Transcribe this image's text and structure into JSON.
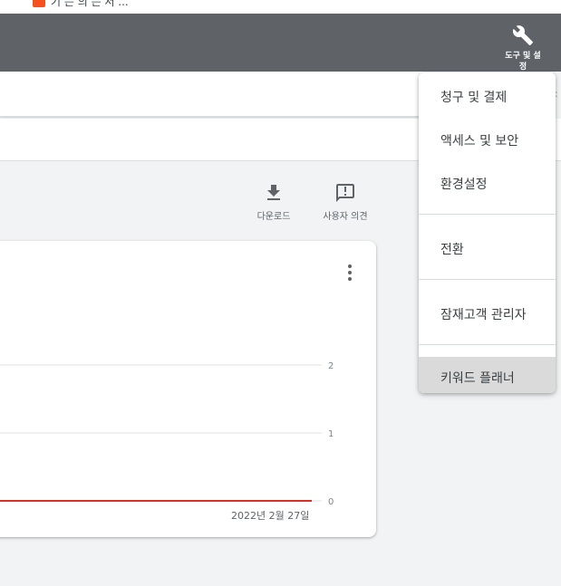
{
  "browser": {
    "bookmark_text": "기 는 의 는 서 ..."
  },
  "header": {
    "tools_label_line1": "도구 및 설",
    "tools_label_line2": "정",
    "tools_icon": "wrench-icon"
  },
  "toolbar": {
    "download_label": "다운로드",
    "feedback_label": "사용자 의견"
  },
  "chart_data": {
    "type": "line",
    "y_ticks": [
      "2",
      "1",
      "0"
    ],
    "ylim": [
      0,
      2
    ],
    "x_end_label": "2022년 2월 27일",
    "series": [
      {
        "values": [
          0,
          0
        ]
      }
    ],
    "series_color": "#d93025",
    "grid": true
  },
  "menu": {
    "groups": [
      [
        "청구 및 결제",
        "액세스 및 보안",
        "환경설정"
      ],
      [
        "전환"
      ],
      [
        "잠재고객 관리자"
      ],
      [
        "키워드 플래너"
      ]
    ],
    "selected": "키워드 플래너"
  },
  "colors": {
    "header_bg": "#5f6368",
    "page_bg": "#f1f3f4",
    "selected_bg": "#dadada"
  }
}
